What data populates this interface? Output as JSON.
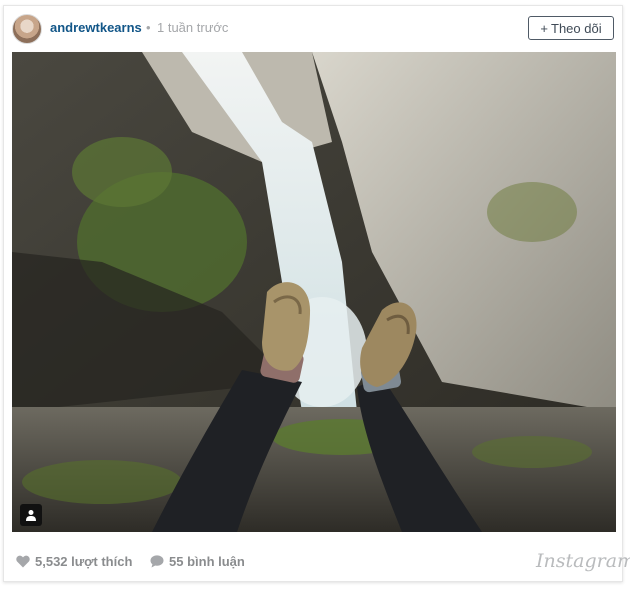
{
  "post": {
    "username": "andrewtkearns",
    "separator": "•",
    "time_ago": "1 tuần trước",
    "follow_label": "Theo dõi",
    "follow_icon": "+"
  },
  "photo": {
    "description_icon": "person-tag-icon"
  },
  "stats": {
    "likes": "5,532 lượt thích",
    "comments": "55 bình luận"
  },
  "brand": {
    "wordmark": "Instagram"
  },
  "colors": {
    "username": "#125688",
    "muted": "#a5a7aa",
    "button_border": "#4f5a66"
  }
}
